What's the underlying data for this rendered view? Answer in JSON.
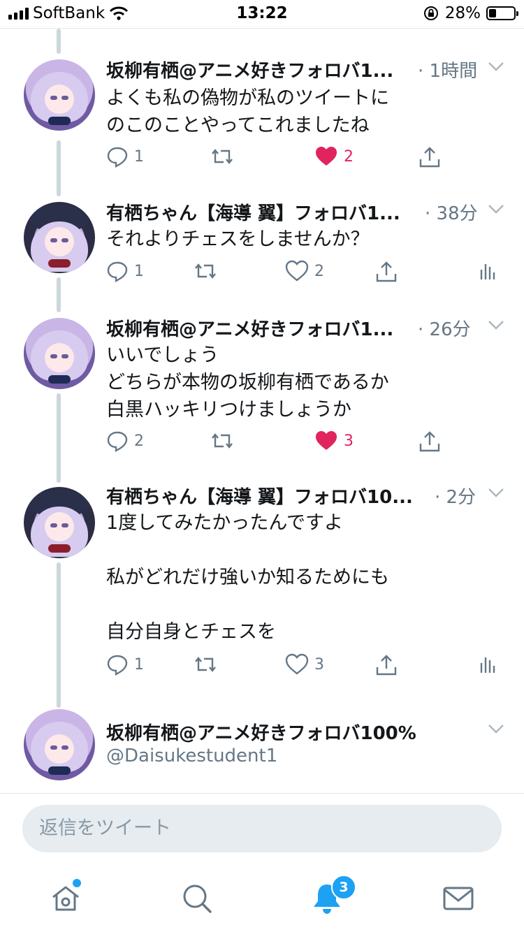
{
  "status_bar": {
    "carrier": "SoftBank",
    "time": "13:22",
    "battery_percent": "28%",
    "battery_level": 0.28
  },
  "tweets": [
    {
      "name": "坂柳有栖@アニメ好きフォロバ1...",
      "time": "· 1時間",
      "text": "よくも私の偽物が私のツイートに\nのこのことやってこれましたね",
      "reply_count": "1",
      "retweet_count": "",
      "like_count": "2",
      "liked": true
    },
    {
      "name": "有栖ちゃん【海導 翼】フォロバ1...",
      "time": "· 38分",
      "text": "それよりチェスをしませんか？",
      "reply_count": "1",
      "retweet_count": "",
      "like_count": "2",
      "liked": false
    },
    {
      "name": "坂柳有栖@アニメ好きフォロバ1...",
      "time": "· 26分",
      "text": "いいでしょう\nどちらが本物の坂柳有栖であるか\n白黒ハッキリつけましょうか",
      "reply_count": "2",
      "retweet_count": "",
      "like_count": "3",
      "liked": true
    },
    {
      "name": "有栖ちゃん【海導 翼】フォロバ10...",
      "time": "· 2分",
      "text": "1度してみたかったんですよ\n\n私がどれだけ強いか知るためにも\n\n自分自身とチェスを",
      "reply_count": "1",
      "retweet_count": "",
      "like_count": "3",
      "liked": false
    }
  ],
  "composer_user": {
    "name": "坂柳有栖@アニメ好きフォロバ100%",
    "handle": "@Daisukestudent1"
  },
  "reply_box": {
    "placeholder": "返信をツイート"
  },
  "tab_bar": {
    "notifications_badge": "3"
  },
  "colors": {
    "accent": "#1da1f2",
    "like": "#e0245e",
    "secondary_text": "#657786"
  }
}
